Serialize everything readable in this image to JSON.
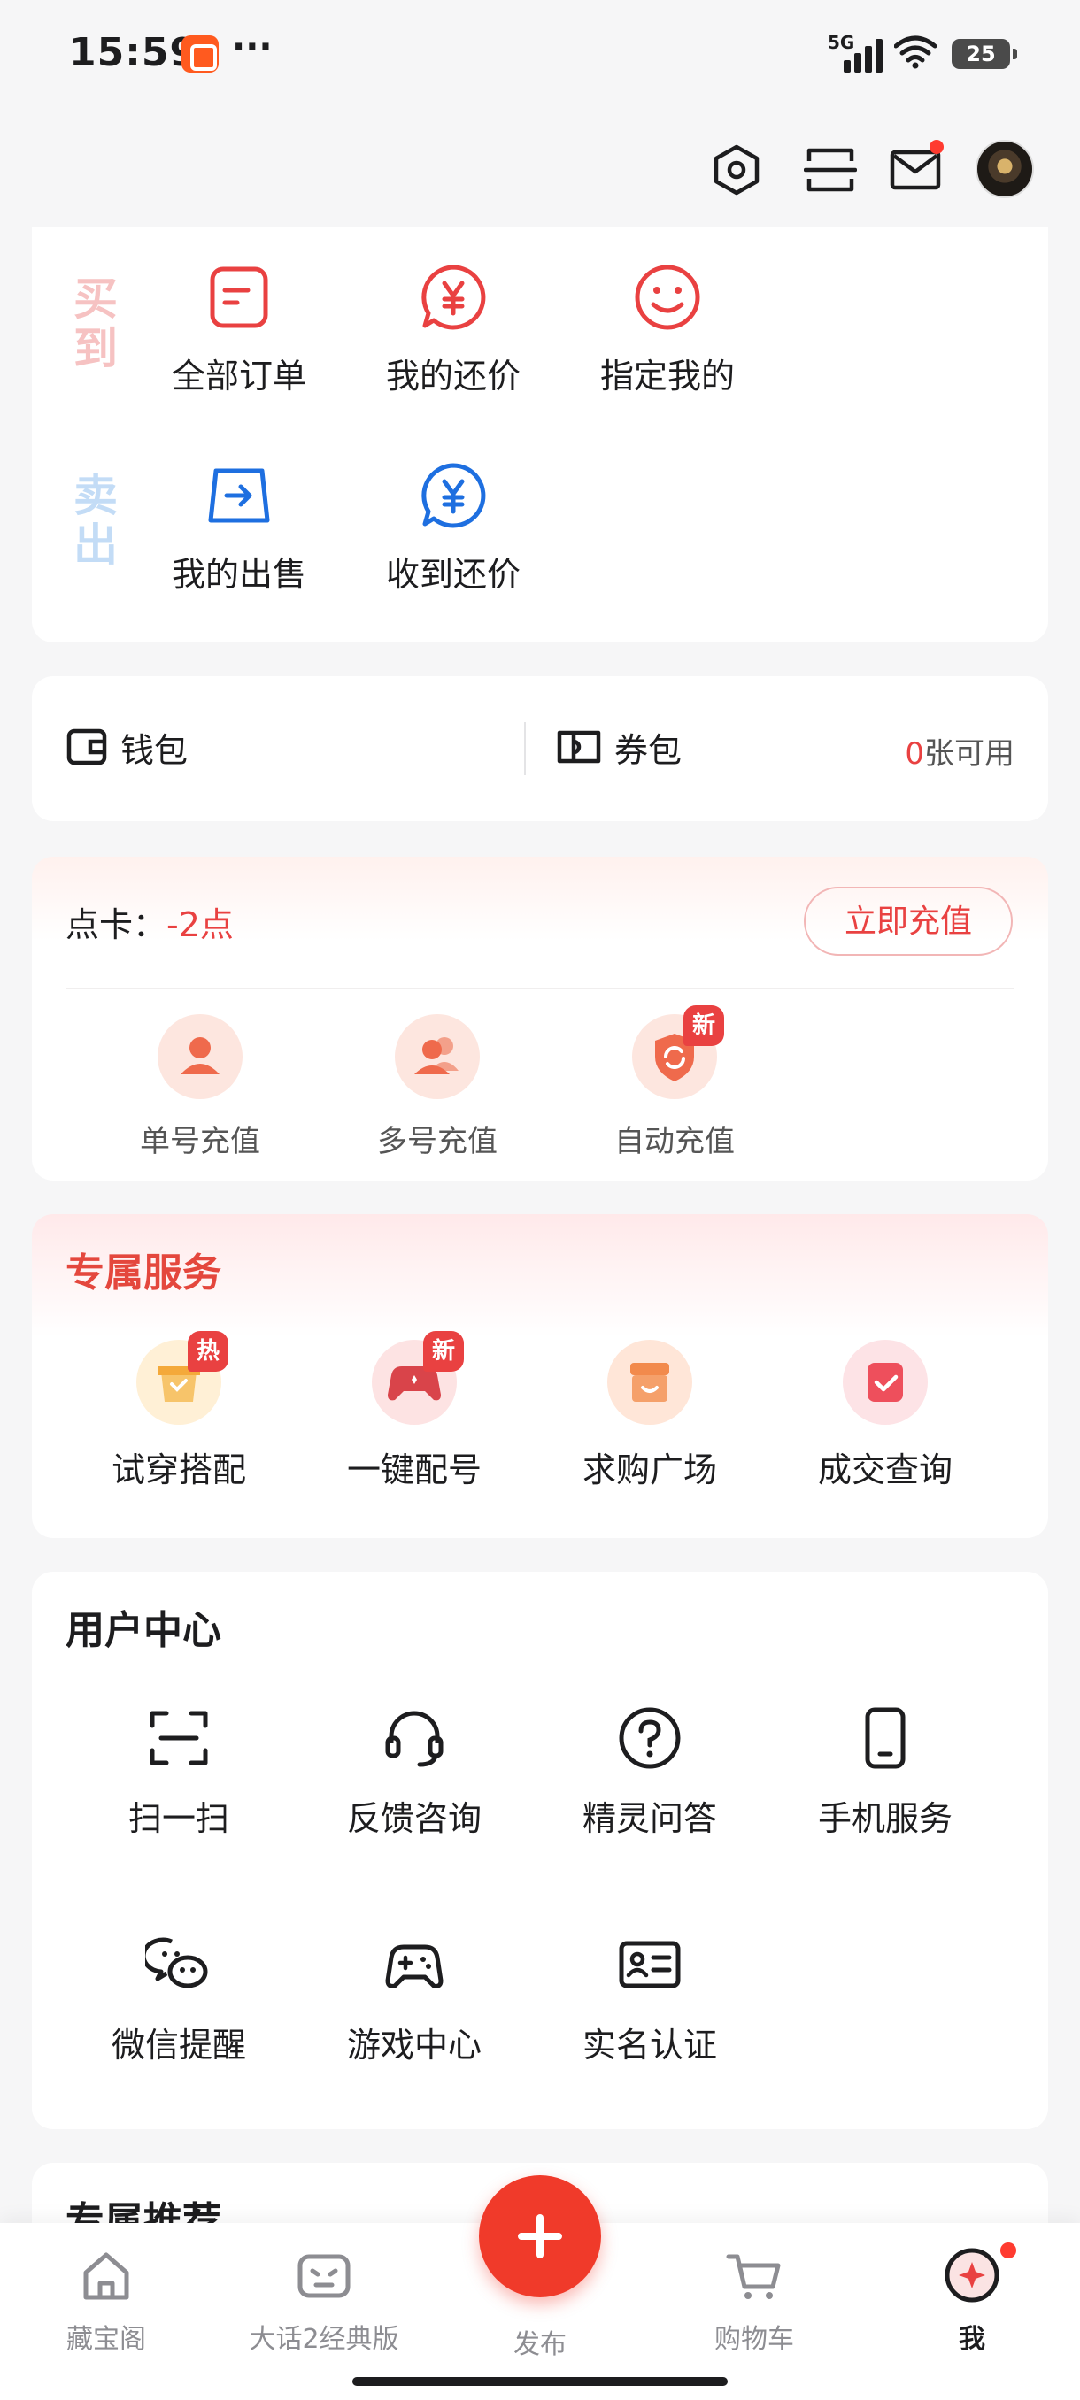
{
  "status_bar": {
    "time": "15:59",
    "network": "5G",
    "battery": "25"
  },
  "header": {
    "icons": [
      "settings-icon",
      "scan-icon",
      "mail-icon"
    ]
  },
  "orders": {
    "buy_label": "买到",
    "sell_label": "卖出",
    "buy_items": [
      {
        "label": "全部订单",
        "icon": "order-list-icon"
      },
      {
        "label": "我的还价",
        "icon": "yen-bubble-icon"
      },
      {
        "label": "指定我的",
        "icon": "smiley-icon"
      }
    ],
    "sell_items": [
      {
        "label": "我的出售",
        "icon": "sell-arrow-icon"
      },
      {
        "label": "收到还价",
        "icon": "yen-bubble-blue-icon"
      }
    ]
  },
  "wallet": {
    "wallet_label": "钱包",
    "coupon_label": "券包",
    "coupon_count": "0",
    "coupon_suffix": "张可用"
  },
  "points": {
    "label": "点卡：",
    "value": "-2点",
    "recharge_button": "立即充值",
    "items": [
      {
        "label": "单号充值",
        "icon": "single-user-icon"
      },
      {
        "label": "多号充值",
        "icon": "multi-user-icon"
      },
      {
        "label": "自动充值",
        "icon": "auto-recharge-icon",
        "badge": "新"
      }
    ]
  },
  "service": {
    "title": "专属服务",
    "items": [
      {
        "label": "试穿搭配",
        "icon": "outfit-box-icon",
        "badge": "热"
      },
      {
        "label": "一键配号",
        "icon": "gamepad-icon",
        "badge": "新"
      },
      {
        "label": "求购广场",
        "icon": "shop-icon"
      },
      {
        "label": "成交查询",
        "icon": "check-card-icon"
      }
    ]
  },
  "user_center": {
    "title": "用户中心",
    "items": [
      {
        "label": "扫一扫",
        "icon": "scan-icon"
      },
      {
        "label": "反馈咨询",
        "icon": "headset-icon"
      },
      {
        "label": "精灵问答",
        "icon": "question-icon"
      },
      {
        "label": "手机服务",
        "icon": "phone-icon"
      },
      {
        "label": "微信提醒",
        "icon": "wechat-icon"
      },
      {
        "label": "游戏中心",
        "icon": "game-controller-icon"
      },
      {
        "label": "实名认证",
        "icon": "id-card-icon"
      }
    ]
  },
  "recommend": {
    "title": "专属推荐"
  },
  "bottom_nav": {
    "items": [
      {
        "label": "藏宝阁",
        "icon": "home-icon"
      },
      {
        "label": "大话2经典版",
        "icon": "game-face-icon"
      },
      {
        "label": "发布",
        "icon": "plus-icon"
      },
      {
        "label": "购物车",
        "icon": "cart-icon"
      },
      {
        "label": "我",
        "icon": "me-icon"
      }
    ]
  },
  "colors": {
    "accent": "#e94141",
    "publish": "#f03a2a",
    "buy_label": "#f6c2c2",
    "sell_label": "#c3dcf6"
  }
}
